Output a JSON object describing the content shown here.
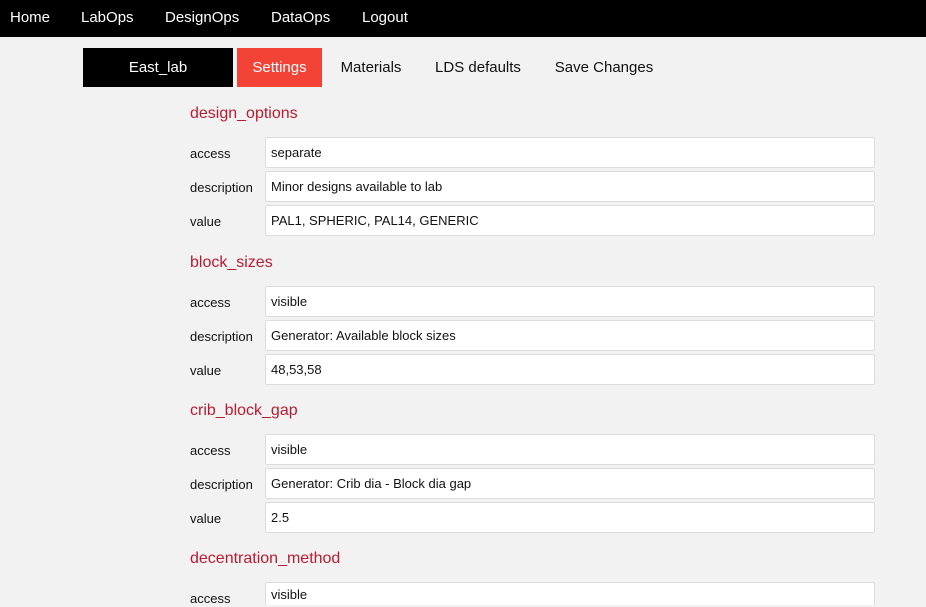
{
  "topnav": {
    "items": [
      "Home",
      "LabOps",
      "DesignOps",
      "DataOps",
      "Logout"
    ]
  },
  "tabs": {
    "lab": "East_lab",
    "settings": "Settings",
    "materials": "Materials",
    "lds_defaults": "LDS defaults",
    "save_changes": "Save Changes"
  },
  "sections": [
    {
      "title": "design_options",
      "rows": [
        {
          "label": "access",
          "value": "separate"
        },
        {
          "label": "description",
          "value": "Minor designs available to lab"
        },
        {
          "label": "value",
          "value": "PAL1, SPHERIC, PAL14, GENERIC"
        }
      ]
    },
    {
      "title": "block_sizes",
      "rows": [
        {
          "label": "access",
          "value": "visible"
        },
        {
          "label": "description",
          "value": "Generator: Available block sizes"
        },
        {
          "label": "value",
          "value": "48,53,58"
        }
      ]
    },
    {
      "title": "crib_block_gap",
      "rows": [
        {
          "label": "access",
          "value": "visible"
        },
        {
          "label": "description",
          "value": "Generator: Crib dia - Block dia gap"
        },
        {
          "label": "value",
          "value": "2.5"
        }
      ]
    },
    {
      "title": "decentration_method",
      "rows": [
        {
          "label": "access",
          "value": "visible"
        }
      ]
    }
  ]
}
